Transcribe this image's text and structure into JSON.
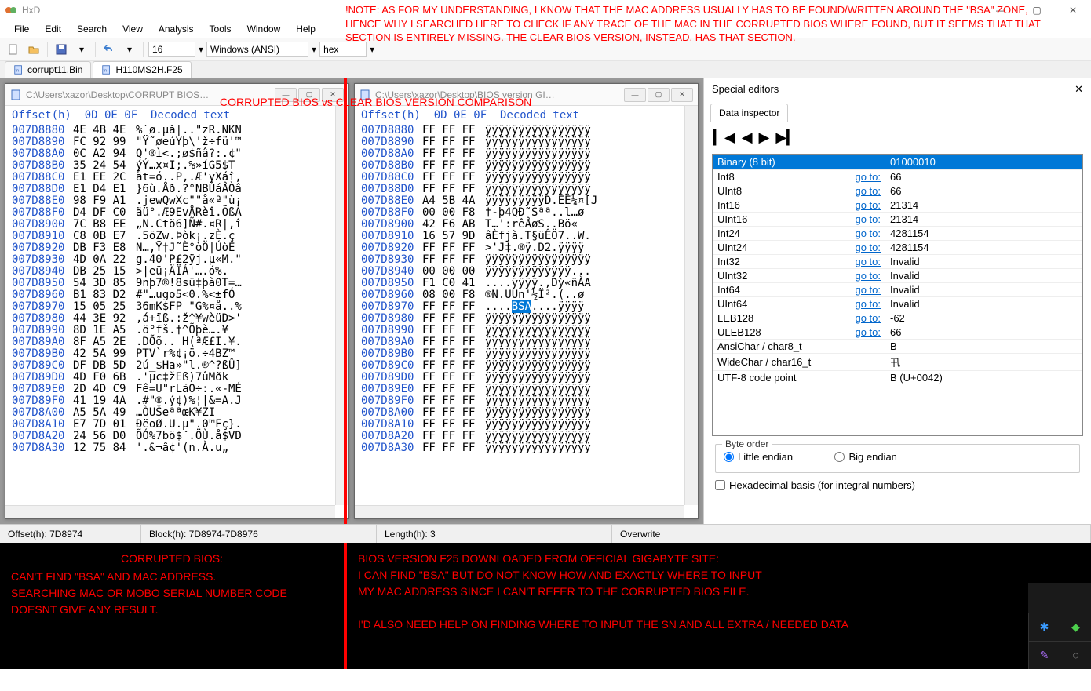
{
  "app": {
    "title": "HxD"
  },
  "menus": [
    "File",
    "Edit",
    "Search",
    "View",
    "Analysis",
    "Tools",
    "Window",
    "Help"
  ],
  "toolbar": {
    "bytes_per_row": "16",
    "encoding": "Windows (ANSI)",
    "datatype": "hex"
  },
  "annot_top": "!NOTE: AS FOR MY UNDERSTANDING, I KNOW THAT THE MAC ADDRESS USUALLY HAS TO BE FOUND/WRITTEN AROUND THE \"BSA\" ZONE, HENCE WHY I SEARCHED HERE TO CHECK IF ANY TRACE OF THE MAC IN THE CORRUPTED BIOS WHERE FOUND, BUT IT SEEMS THAT THAT SECTION IS ENTIRELY MISSING. THE CLEAR BIOS VERSION, INSTEAD, HAS THAT SECTION.",
  "tabs": [
    {
      "label": "corrupt11.Bin",
      "active": false
    },
    {
      "label": "H110MS2H.F25",
      "active": true
    }
  ],
  "annot_mid": "CORRUPTED BIOS vs CLEAR BIOS VERSION COMPARISON",
  "hex_header": "Offset(h)  0D 0E 0F  Decoded text",
  "left_pane": {
    "title": "C:\\Users\\xazor\\Desktop\\CORRUPT BIOS…",
    "rows": [
      {
        "off": "007D8880",
        "b": "4E 4B 4E",
        "t": "%´ø.µå|..\"zR.NKN"
      },
      {
        "off": "007D8890",
        "b": "FC 92 99",
        "t": "\"Ÿ˜øeúYþ\\'ž÷fü'™"
      },
      {
        "off": "007D88A0",
        "b": "0C A2 94",
        "t": "Q'®ì<.;ø$ñâ?:.¢\""
      },
      {
        "off": "007D88B0",
        "b": "35 24 54",
        "t": "ýÝ…x¤I;.%»íG5$T"
      },
      {
        "off": "007D88C0",
        "b": "E1 EE 2C",
        "t": "åt=ó..P,.Æ'yXáî,"
      },
      {
        "off": "007D88D0",
        "b": "E1 D4 E1",
        "t": "}6ù.Åð.?°NBÚáÅÒâ"
      },
      {
        "off": "007D88E0",
        "b": "98 F9 A1",
        "t": ".jewQwXc\"\"å«ª\"ù¡"
      },
      {
        "off": "007D88F0",
        "b": "D4 DF C0",
        "t": "äü°.Æ9EvÅRèî.ÕßÀ"
      },
      {
        "off": "007D8900",
        "b": "7C B8 EE",
        "t": "„N.Ctö6]Ñ#.¤R|‚î"
      },
      {
        "off": "007D8910",
        "b": "C8 0B E7",
        "t": ".5öZw.Þòk¡.zÈ.ç"
      },
      {
        "off": "007D8920",
        "b": "DB F3 E8",
        "t": "N…,Ÿ†J˜È°òÖ|ÚòÈ"
      },
      {
        "off": "007D8930",
        "b": "4D 0A 22",
        "t": "g.40'P£2ÿj.µ«M.\""
      },
      {
        "off": "007D8940",
        "b": "DB 25 15",
        "t": ">|eü¡ÄÏÁ'….ó%."
      },
      {
        "off": "007D8950",
        "b": "54 3D 85",
        "t": "9nþ7®!8sü‡þà0T=…"
      },
      {
        "off": "007D8960",
        "b": "B1 83 D2",
        "t": "#\"…ugo5<0.%<±fÓ"
      },
      {
        "off": "007D8970",
        "b": "15 05 25",
        "t": "36mK$FP \"G%¤å..%"
      },
      {
        "off": "007D8980",
        "b": "44 3E 92",
        "t": ",á+ïß.:ž^¥wèüD>'"
      },
      {
        "off": "007D8990",
        "b": "8D 1E A5",
        "t": ".ö°fš.†^Õþè….¥"
      },
      {
        "off": "007D89A0",
        "b": "8F A5 2E",
        "t": ".DÕõ.. H(ªÆ£I.¥."
      },
      {
        "off": "007D89B0",
        "b": "42 5A 99",
        "t": "PTV`r%¢¡ö.÷4BZ™"
      },
      {
        "off": "007D89C0",
        "b": "DF DB 5D",
        "t": "2ú_$Ha»\"l.®^?ßÛ]"
      },
      {
        "off": "007D89D0",
        "b": "4D F0 6B",
        "t": ".'µc‡žEß)7ûMðk"
      },
      {
        "off": "007D89E0",
        "b": "2D 4D C9",
        "t": "Fê=U\"rLãO÷:.«-MÉ"
      },
      {
        "off": "007D89F0",
        "b": "41 19 4A",
        "t": ".#\"®.ý¢)%¦|&=A.J"
      },
      {
        "off": "007D8A00",
        "b": "A5 5A 49",
        "t": "…ÒUŠeªªœK¥ZI"
      },
      {
        "off": "007D8A10",
        "b": "E7 7D 01",
        "t": "ÐëoØ.U.µ\".0™Fç}."
      },
      {
        "off": "007D8A20",
        "b": "24 56 D0",
        "t": "ÕÓ%7bö$˜.ÖÙ.å$VÐ"
      },
      {
        "off": "007D8A30",
        "b": "12 75 84",
        "t": "'.&¬â¢'(n.À.u„"
      }
    ]
  },
  "right_pane": {
    "title": "C:\\Users\\xazor\\Desktop\\BIOS version GI…",
    "rows": [
      {
        "off": "007D8880",
        "b": "FF FF FF",
        "t": "ÿÿÿÿÿÿÿÿÿÿÿÿÿÿÿÿ"
      },
      {
        "off": "007D8890",
        "b": "FF FF FF",
        "t": "ÿÿÿÿÿÿÿÿÿÿÿÿÿÿÿÿ"
      },
      {
        "off": "007D88A0",
        "b": "FF FF FF",
        "t": "ÿÿÿÿÿÿÿÿÿÿÿÿÿÿÿÿ"
      },
      {
        "off": "007D88B0",
        "b": "FF FF FF",
        "t": "ÿÿÿÿÿÿÿÿÿÿÿÿÿÿÿÿ"
      },
      {
        "off": "007D88C0",
        "b": "FF FF FF",
        "t": "ÿÿÿÿÿÿÿÿÿÿÿÿÿÿÿÿ"
      },
      {
        "off": "007D88D0",
        "b": "FF FF FF",
        "t": "ÿÿÿÿÿÿÿÿÿÿÿÿÿÿÿÿ"
      },
      {
        "off": "007D88E0",
        "b": "A4 5B 4A",
        "t": "ÿÿÿÿÿÿÿÿÿD.ÊÊ¼¤[J"
      },
      {
        "off": "007D88F0",
        "b": "00 00 F8",
        "t": "†-þ4QÐ˜Sªª..l…ø"
      },
      {
        "off": "007D8900",
        "b": "42 F6 AB",
        "t": "T…':rêÅøS..Bö«"
      },
      {
        "off": "007D8910",
        "b": "16 57 9D",
        "t": "âÈfjà.T§üÊÖ7..W."
      },
      {
        "off": "007D8920",
        "b": "FF FF FF",
        "t": ">'J‡.®ÿ.D2.ÿÿÿÿ"
      },
      {
        "off": "007D8930",
        "b": "FF FF FF",
        "t": "ÿÿÿÿÿÿÿÿÿÿÿÿÿÿÿÿ"
      },
      {
        "off": "007D8940",
        "b": "00 00 00",
        "t": "ÿÿÿÿÿÿÿÿÿÿÿÿÿ..."
      },
      {
        "off": "007D8950",
        "b": "F1 C0 41",
        "t": "....ÿÿÿÿ.,Dỳ«ñÀA"
      },
      {
        "off": "007D8960",
        "b": "08 00 F8",
        "t": "®N.UUn'½Ï².(..ø"
      },
      {
        "off": "007D8970",
        "b": "FF FF FF",
        "t": "....",
        "sel": "BSA",
        "rest": "....ÿÿÿÿ"
      },
      {
        "off": "007D8980",
        "b": "FF FF FF",
        "t": "ÿÿÿÿÿÿÿÿÿÿÿÿÿÿÿÿ"
      },
      {
        "off": "007D8990",
        "b": "FF FF FF",
        "t": "ÿÿÿÿÿÿÿÿÿÿÿÿÿÿÿÿ"
      },
      {
        "off": "007D89A0",
        "b": "FF FF FF",
        "t": "ÿÿÿÿÿÿÿÿÿÿÿÿÿÿÿÿ"
      },
      {
        "off": "007D89B0",
        "b": "FF FF FF",
        "t": "ÿÿÿÿÿÿÿÿÿÿÿÿÿÿÿÿ"
      },
      {
        "off": "007D89C0",
        "b": "FF FF FF",
        "t": "ÿÿÿÿÿÿÿÿÿÿÿÿÿÿÿÿ"
      },
      {
        "off": "007D89D0",
        "b": "FF FF FF",
        "t": "ÿÿÿÿÿÿÿÿÿÿÿÿÿÿÿÿ"
      },
      {
        "off": "007D89E0",
        "b": "FF FF FF",
        "t": "ÿÿÿÿÿÿÿÿÿÿÿÿÿÿÿÿ"
      },
      {
        "off": "007D89F0",
        "b": "FF FF FF",
        "t": "ÿÿÿÿÿÿÿÿÿÿÿÿÿÿÿÿ"
      },
      {
        "off": "007D8A00",
        "b": "FF FF FF",
        "t": "ÿÿÿÿÿÿÿÿÿÿÿÿÿÿÿÿ"
      },
      {
        "off": "007D8A10",
        "b": "FF FF FF",
        "t": "ÿÿÿÿÿÿÿÿÿÿÿÿÿÿÿÿ"
      },
      {
        "off": "007D8A20",
        "b": "FF FF FF",
        "t": "ÿÿÿÿÿÿÿÿÿÿÿÿÿÿÿÿ"
      },
      {
        "off": "007D8A30",
        "b": "FF FF FF",
        "t": "ÿÿÿÿÿÿÿÿÿÿÿÿÿÿÿÿ"
      }
    ]
  },
  "special_editors": {
    "title": "Special editors",
    "tab": "Data inspector",
    "header": {
      "type": "Binary (8 bit)",
      "value": "01000010"
    },
    "goto_label": "go to:",
    "rows": [
      {
        "name": "Int8",
        "value": "66"
      },
      {
        "name": "UInt8",
        "value": "66"
      },
      {
        "name": "Int16",
        "value": "21314"
      },
      {
        "name": "UInt16",
        "value": "21314"
      },
      {
        "name": "Int24",
        "value": "4281154"
      },
      {
        "name": "UInt24",
        "value": "4281154"
      },
      {
        "name": "Int32",
        "value": "Invalid"
      },
      {
        "name": "UInt32",
        "value": "Invalid"
      },
      {
        "name": "Int64",
        "value": "Invalid"
      },
      {
        "name": "UInt64",
        "value": "Invalid"
      },
      {
        "name": "LEB128",
        "value": "-62"
      },
      {
        "name": "ULEB128",
        "value": "66"
      },
      {
        "name": "AnsiChar / char8_t",
        "value": "B",
        "nogoto": true
      },
      {
        "name": "WideChar / char16_t",
        "value": "卂",
        "nogoto": true
      },
      {
        "name": "UTF-8 code point",
        "value": "B (U+0042)",
        "nogoto": true
      }
    ],
    "byteorder": {
      "legend": "Byte order",
      "little": "Little endian",
      "big": "Big endian"
    },
    "hexbasis": "Hexadecimal basis (for integral numbers)"
  },
  "status": {
    "offset": "Offset(h): 7D8974",
    "block": "Block(h): 7D8974-7D8976",
    "length": "Length(h): 3",
    "mode": "Overwrite"
  },
  "bottom": {
    "left_title": "CORRUPTED BIOS:",
    "left_body": "CAN'T FIND \"BSA\" AND MAC ADDRESS.\nSEARCHING MAC OR MOBO SERIAL NUMBER CODE DOESNT GIVE ANY RESULT.",
    "right_title": "BIOS VERSION F25 DOWNLOADED FROM OFFICIAL GIGABYTE SITE:",
    "right_body": "I CAN FIND \"BSA\" BUT DO NOT KNOW HOW AND EXACTLY WHERE TO INPUT\nMY MAC ADDRESS SINCE I CAN'T REFER TO THE CORRUPTED BIOS FILE.\n\nI'D ALSO NEED HELP ON FINDING WHERE TO INPUT THE SN AND ALL EXTRA / NEEDED DATA"
  }
}
